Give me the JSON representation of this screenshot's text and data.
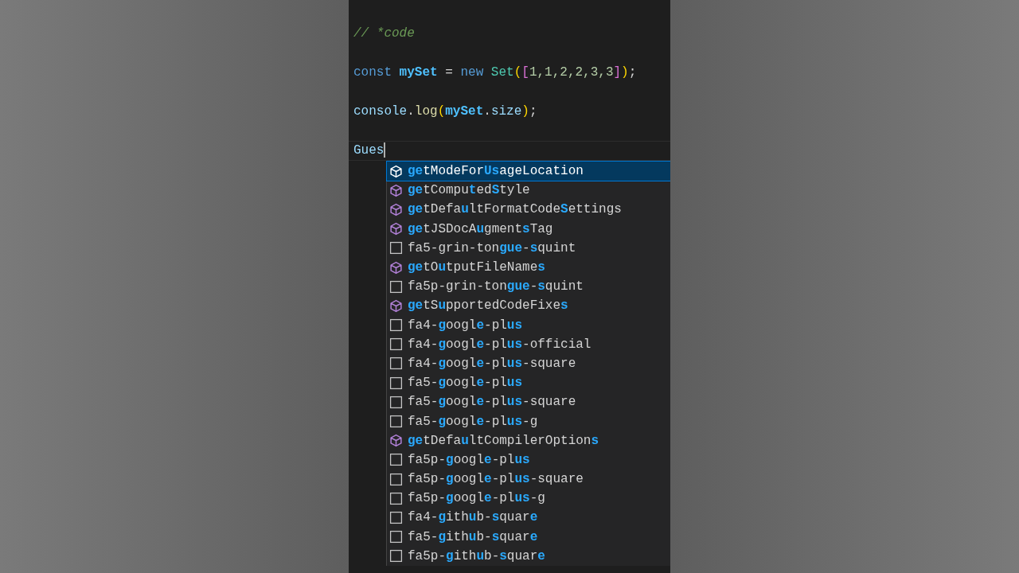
{
  "editor": {
    "lines": [
      {
        "cursor": false,
        "tokens": [
          {
            "kind": "comment",
            "text": "// *code"
          }
        ]
      },
      {
        "cursor": false,
        "tokens": [
          {
            "kind": "keyword",
            "text": "const "
          },
          {
            "kind": "constant",
            "text": "mySet"
          },
          {
            "kind": "plain",
            "text": " = "
          },
          {
            "kind": "keyword",
            "text": "new "
          },
          {
            "kind": "class",
            "text": "Set"
          },
          {
            "kind": "bracket1",
            "text": "("
          },
          {
            "kind": "bracket2",
            "text": "["
          },
          {
            "kind": "number",
            "text": "1,1,2,2,3,3"
          },
          {
            "kind": "bracket2",
            "text": "]"
          },
          {
            "kind": "bracket1",
            "text": ")"
          },
          {
            "kind": "plain",
            "text": ";"
          }
        ]
      },
      {
        "cursor": false,
        "tokens": [
          {
            "kind": "variable",
            "text": "console"
          },
          {
            "kind": "plain",
            "text": "."
          },
          {
            "kind": "function",
            "text": "log"
          },
          {
            "kind": "bracket1",
            "text": "("
          },
          {
            "kind": "constant",
            "text": "mySet"
          },
          {
            "kind": "plain",
            "text": "."
          },
          {
            "kind": "variable",
            "text": "size"
          },
          {
            "kind": "bracket1",
            "text": ")"
          },
          {
            "kind": "plain",
            "text": ";"
          }
        ]
      },
      {
        "cursor": true,
        "tokens": [
          {
            "kind": "variable",
            "text": "Gues"
          }
        ]
      }
    ]
  },
  "suggestions": [
    {
      "kind": "method",
      "selected": true,
      "parts": [
        {
          "text": "ge",
          "match": true
        },
        {
          "text": "tModeFor",
          "match": false
        },
        {
          "text": "Us",
          "match": true
        },
        {
          "text": "ageLocation",
          "match": false
        }
      ]
    },
    {
      "kind": "method",
      "selected": false,
      "parts": [
        {
          "text": "ge",
          "match": true
        },
        {
          "text": "tCompu",
          "match": false
        },
        {
          "text": "t",
          "match": true
        },
        {
          "text": "ed",
          "match": false
        },
        {
          "text": "S",
          "match": true
        },
        {
          "text": "tyle",
          "match": false
        }
      ]
    },
    {
      "kind": "method",
      "selected": false,
      "parts": [
        {
          "text": "ge",
          "match": true
        },
        {
          "text": "tDefa",
          "match": false
        },
        {
          "text": "u",
          "match": true
        },
        {
          "text": "ltFormatCode",
          "match": false
        },
        {
          "text": "S",
          "match": true
        },
        {
          "text": "ettings",
          "match": false
        }
      ]
    },
    {
      "kind": "method",
      "selected": false,
      "parts": [
        {
          "text": "ge",
          "match": true
        },
        {
          "text": "tJSDocA",
          "match": false
        },
        {
          "text": "u",
          "match": true
        },
        {
          "text": "gment",
          "match": false
        },
        {
          "text": "s",
          "match": true
        },
        {
          "text": "Tag",
          "match": false
        }
      ]
    },
    {
      "kind": "text",
      "selected": false,
      "parts": [
        {
          "text": "fa5-grin-ton",
          "match": false
        },
        {
          "text": "gue",
          "match": true
        },
        {
          "text": "-",
          "match": false
        },
        {
          "text": "s",
          "match": true
        },
        {
          "text": "quint",
          "match": false
        }
      ]
    },
    {
      "kind": "method",
      "selected": false,
      "parts": [
        {
          "text": "ge",
          "match": true
        },
        {
          "text": "tO",
          "match": false
        },
        {
          "text": "u",
          "match": true
        },
        {
          "text": "tputFileName",
          "match": false
        },
        {
          "text": "s",
          "match": true
        }
      ]
    },
    {
      "kind": "text",
      "selected": false,
      "parts": [
        {
          "text": "fa5p-grin-ton",
          "match": false
        },
        {
          "text": "gue",
          "match": true
        },
        {
          "text": "-",
          "match": false
        },
        {
          "text": "s",
          "match": true
        },
        {
          "text": "quint",
          "match": false
        }
      ]
    },
    {
      "kind": "method",
      "selected": false,
      "parts": [
        {
          "text": "ge",
          "match": true
        },
        {
          "text": "tS",
          "match": false
        },
        {
          "text": "u",
          "match": true
        },
        {
          "text": "pportedCodeFixe",
          "match": false
        },
        {
          "text": "s",
          "match": true
        }
      ]
    },
    {
      "kind": "text",
      "selected": false,
      "parts": [
        {
          "text": "fa4-",
          "match": false
        },
        {
          "text": "g",
          "match": true
        },
        {
          "text": "oogl",
          "match": false
        },
        {
          "text": "e",
          "match": true
        },
        {
          "text": "-pl",
          "match": false
        },
        {
          "text": "us",
          "match": true
        }
      ]
    },
    {
      "kind": "text",
      "selected": false,
      "parts": [
        {
          "text": "fa4-",
          "match": false
        },
        {
          "text": "g",
          "match": true
        },
        {
          "text": "oogl",
          "match": false
        },
        {
          "text": "e",
          "match": true
        },
        {
          "text": "-pl",
          "match": false
        },
        {
          "text": "us",
          "match": true
        },
        {
          "text": "-official",
          "match": false
        }
      ]
    },
    {
      "kind": "text",
      "selected": false,
      "parts": [
        {
          "text": "fa4-",
          "match": false
        },
        {
          "text": "g",
          "match": true
        },
        {
          "text": "oogl",
          "match": false
        },
        {
          "text": "e",
          "match": true
        },
        {
          "text": "-pl",
          "match": false
        },
        {
          "text": "us",
          "match": true
        },
        {
          "text": "-square",
          "match": false
        }
      ]
    },
    {
      "kind": "text",
      "selected": false,
      "parts": [
        {
          "text": "fa5-",
          "match": false
        },
        {
          "text": "g",
          "match": true
        },
        {
          "text": "oogl",
          "match": false
        },
        {
          "text": "e",
          "match": true
        },
        {
          "text": "-pl",
          "match": false
        },
        {
          "text": "us",
          "match": true
        }
      ]
    },
    {
      "kind": "text",
      "selected": false,
      "parts": [
        {
          "text": "fa5-",
          "match": false
        },
        {
          "text": "g",
          "match": true
        },
        {
          "text": "oogl",
          "match": false
        },
        {
          "text": "e",
          "match": true
        },
        {
          "text": "-pl",
          "match": false
        },
        {
          "text": "us",
          "match": true
        },
        {
          "text": "-square",
          "match": false
        }
      ]
    },
    {
      "kind": "text",
      "selected": false,
      "parts": [
        {
          "text": "fa5-",
          "match": false
        },
        {
          "text": "g",
          "match": true
        },
        {
          "text": "oogl",
          "match": false
        },
        {
          "text": "e",
          "match": true
        },
        {
          "text": "-pl",
          "match": false
        },
        {
          "text": "us",
          "match": true
        },
        {
          "text": "-g",
          "match": false
        }
      ]
    },
    {
      "kind": "method",
      "selected": false,
      "parts": [
        {
          "text": "ge",
          "match": true
        },
        {
          "text": "tDefa",
          "match": false
        },
        {
          "text": "u",
          "match": true
        },
        {
          "text": "ltCompilerOption",
          "match": false
        },
        {
          "text": "s",
          "match": true
        }
      ]
    },
    {
      "kind": "text",
      "selected": false,
      "parts": [
        {
          "text": "fa5p-",
          "match": false
        },
        {
          "text": "g",
          "match": true
        },
        {
          "text": "oogl",
          "match": false
        },
        {
          "text": "e",
          "match": true
        },
        {
          "text": "-pl",
          "match": false
        },
        {
          "text": "us",
          "match": true
        }
      ]
    },
    {
      "kind": "text",
      "selected": false,
      "parts": [
        {
          "text": "fa5p-",
          "match": false
        },
        {
          "text": "g",
          "match": true
        },
        {
          "text": "oogl",
          "match": false
        },
        {
          "text": "e",
          "match": true
        },
        {
          "text": "-pl",
          "match": false
        },
        {
          "text": "us",
          "match": true
        },
        {
          "text": "-square",
          "match": false
        }
      ]
    },
    {
      "kind": "text",
      "selected": false,
      "parts": [
        {
          "text": "fa5p-",
          "match": false
        },
        {
          "text": "g",
          "match": true
        },
        {
          "text": "oogl",
          "match": false
        },
        {
          "text": "e",
          "match": true
        },
        {
          "text": "-pl",
          "match": false
        },
        {
          "text": "us",
          "match": true
        },
        {
          "text": "-g",
          "match": false
        }
      ]
    },
    {
      "kind": "text",
      "selected": false,
      "parts": [
        {
          "text": "fa4-",
          "match": false
        },
        {
          "text": "g",
          "match": true
        },
        {
          "text": "ith",
          "match": false
        },
        {
          "text": "u",
          "match": true
        },
        {
          "text": "b-",
          "match": false
        },
        {
          "text": "s",
          "match": true
        },
        {
          "text": "quar",
          "match": false
        },
        {
          "text": "e",
          "match": true
        }
      ]
    },
    {
      "kind": "text",
      "selected": false,
      "parts": [
        {
          "text": "fa5-",
          "match": false
        },
        {
          "text": "g",
          "match": true
        },
        {
          "text": "ith",
          "match": false
        },
        {
          "text": "u",
          "match": true
        },
        {
          "text": "b-",
          "match": false
        },
        {
          "text": "s",
          "match": true
        },
        {
          "text": "quar",
          "match": false
        },
        {
          "text": "e",
          "match": true
        }
      ]
    },
    {
      "kind": "text",
      "selected": false,
      "parts": [
        {
          "text": "fa5p-",
          "match": false
        },
        {
          "text": "g",
          "match": true
        },
        {
          "text": "ith",
          "match": false
        },
        {
          "text": "u",
          "match": true
        },
        {
          "text": "b-",
          "match": false
        },
        {
          "text": "s",
          "match": true
        },
        {
          "text": "quar",
          "match": false
        },
        {
          "text": "e",
          "match": true
        }
      ]
    }
  ]
}
